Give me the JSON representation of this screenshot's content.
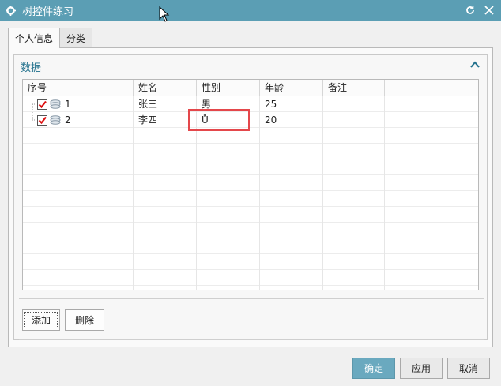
{
  "window": {
    "title": "树控件练习"
  },
  "tabs": [
    {
      "label": "个人信息",
      "active": true
    },
    {
      "label": "分类",
      "active": false
    }
  ],
  "group": {
    "title": "数据"
  },
  "tree": {
    "columns": [
      "序号",
      "姓名",
      "性别",
      "年龄",
      "备注"
    ],
    "rows": [
      {
        "id": "1",
        "name": "张三",
        "gender": "男",
        "age": "25",
        "note": ""
      },
      {
        "id": "2",
        "name": "李四",
        "gender": "Ů",
        "age": "20",
        "note": ""
      }
    ]
  },
  "buttons": {
    "add": "添加",
    "delete": "删除"
  },
  "footer": {
    "ok": "确定",
    "apply": "应用",
    "cancel": "取消"
  },
  "colors": {
    "titlebar": "#5b9eb4",
    "accent": "#1f6f8b",
    "primary_button": "#6aa9bf",
    "highlight": "#e4474b"
  }
}
